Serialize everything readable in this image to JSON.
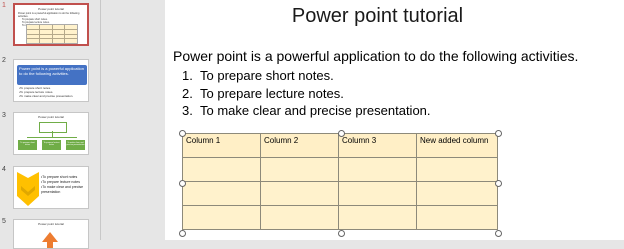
{
  "thumbnails": [
    {
      "number": "1",
      "title": "Power point tutorial",
      "intro": "Power point is a powerful application to do the following activities.",
      "items": [
        "To prepare short notes.",
        "To prepare lecture notes.",
        "To make clear and precise presentation."
      ]
    },
    {
      "number": "2",
      "box_text": "Power point is a powerful application to do the following activities.",
      "bullets": [
        "•To prepare short notes.",
        "•To prepare lecture notes.",
        "•To make clear and precise presentation."
      ]
    },
    {
      "number": "3",
      "title": "Power point tutorial",
      "boxes": [
        "To prepare short notes",
        "To prepare lecture notes",
        "To make clear and precise presentation"
      ]
    },
    {
      "number": "4",
      "bullets": [
        "•To prepare short notes",
        "•To prepare lecture notes",
        "•To make clear and precise presentation"
      ]
    },
    {
      "number": "5",
      "title": "Power point tutorial"
    }
  ],
  "slide": {
    "title": "Power point tutorial",
    "body": "Power point is a powerful application to do the following activities.",
    "list": [
      {
        "num": "1.",
        "text": "To prepare short notes."
      },
      {
        "num": "2.",
        "text": "To prepare lecture notes."
      },
      {
        "num": "3.",
        "text": "To make clear and precise presentation."
      }
    ],
    "table": {
      "headers": [
        "Column 1",
        "Column 2",
        "Column 3",
        "New added column"
      ],
      "rows": 3
    }
  },
  "colors": {
    "selection": "#c0504d",
    "table_fill": "#fff2cc",
    "thumb2_box": "#4472c4",
    "thumb3_box": "#70ad47",
    "thumb4_chevron": "#ffc000",
    "thumb5_shape": "#ed7d31"
  }
}
